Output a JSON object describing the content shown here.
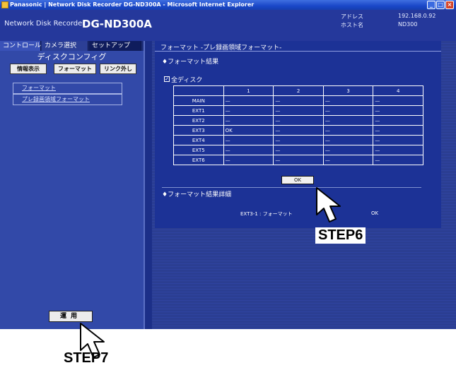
{
  "window": {
    "title": "Panasonic | Network Disk Recorder DG-ND300A - Microsoft Internet Explorer"
  },
  "header": {
    "brand": "Network Disk Recorder",
    "model": "DG-ND300A",
    "address_label": "アドレス",
    "address_value": "192.168.0.92",
    "host_label": "ホスト名",
    "host_value": "ND300"
  },
  "tabs": [
    {
      "label": "コントロール"
    },
    {
      "label": "カメラ選択"
    },
    {
      "label": "セットアップ"
    }
  ],
  "sidebar": {
    "section_title": "ディスクコンフィグ",
    "buttons": [
      {
        "label": "情報表示"
      },
      {
        "label": "フォーマット"
      },
      {
        "label": "リンク外し"
      }
    ],
    "nav": [
      {
        "label": "フォーマット"
      },
      {
        "label": "プレ録画領域フォーマット"
      }
    ],
    "apply_label": "運用"
  },
  "main": {
    "title": "フォーマット -プレ録画領域フォーマット-",
    "result_heading": "♦フォーマット結果",
    "all_disk_label": "全ディスク",
    "table": {
      "columns": [
        "",
        "1",
        "2",
        "3",
        "4"
      ],
      "rows": [
        {
          "label": "MAIN",
          "cells": [
            "—",
            "—",
            "—",
            "—"
          ]
        },
        {
          "label": "EXT1",
          "cells": [
            "—",
            "—",
            "—",
            "—"
          ]
        },
        {
          "label": "EXT2",
          "cells": [
            "—",
            "—",
            "—",
            "—"
          ]
        },
        {
          "label": "EXT3",
          "cells": [
            "OK",
            "—",
            "—",
            "—"
          ]
        },
        {
          "label": "EXT4",
          "cells": [
            "—",
            "—",
            "—",
            "—"
          ]
        },
        {
          "label": "EXT5",
          "cells": [
            "—",
            "—",
            "—",
            "—"
          ]
        },
        {
          "label": "EXT6",
          "cells": [
            "—",
            "—",
            "—",
            "—"
          ]
        }
      ]
    },
    "ok_label": "OK",
    "detail_heading": "♦フォーマット結果詳細",
    "detail_item": "EXT3-1 : フォーマット",
    "detail_status": "OK"
  },
  "annotations": {
    "step6": "STEP6",
    "step7": "STEP7"
  },
  "colors": {
    "header": "#25389b",
    "sidebar": "#3249a8",
    "panel": "#1c3296",
    "titlebar": "#1a47c8"
  }
}
